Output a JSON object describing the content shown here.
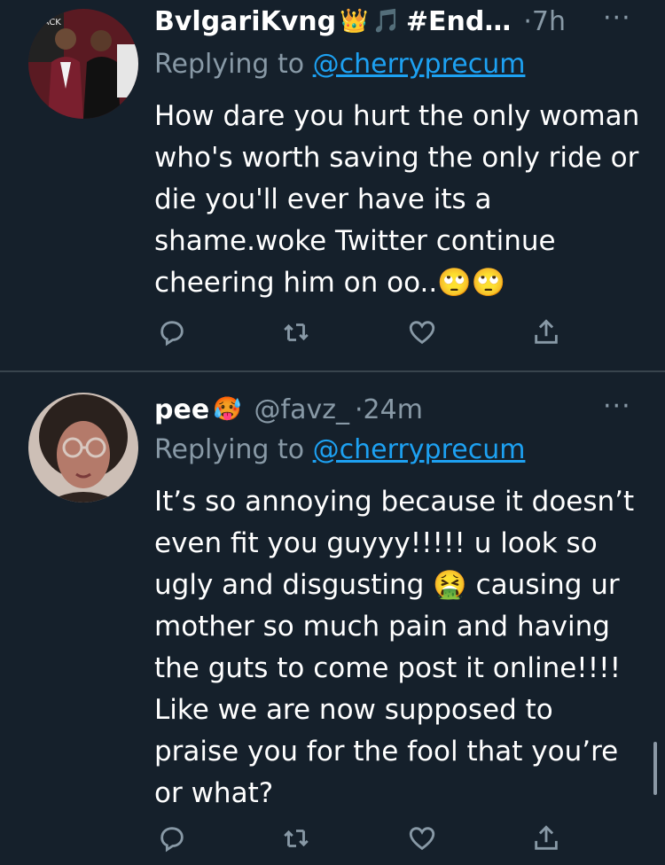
{
  "tweets": [
    {
      "display_name": "BvlgariKvng",
      "name_suffix": "#End…",
      "crown_emoji": "👑",
      "music_emoji": "🎵",
      "time": "·7h",
      "more": "···",
      "replying_prefix": "Replying to ",
      "replying_to": "@cherryprecum",
      "text": "How dare you hurt the only woman who's worth saving the only ride or die you'll ever have its a shame.woke Twitter continue cheering him on oo..🙄🙄"
    },
    {
      "display_name": "pee",
      "name_emoji": "🥵",
      "handle": "@favz_",
      "time": "·24m",
      "more": "···",
      "replying_prefix": "Replying to ",
      "replying_to": "@cherryprecum",
      "text": "It’s so annoying because it doesn’t even fit you guyyy!!!!! u look so ugly and disgusting 🤮 causing ur mother so much pain and having the guts to come post it online!!!! Like we are now supposed to praise you for the fool that you’re or what?"
    }
  ],
  "icons": {
    "reply": "reply-icon",
    "retweet": "retweet-icon",
    "like": "like-icon",
    "share": "share-icon"
  },
  "colors": {
    "background": "#15202b",
    "secondary_text": "#8899a6",
    "link": "#1da1f2",
    "divider": "#38444d"
  }
}
